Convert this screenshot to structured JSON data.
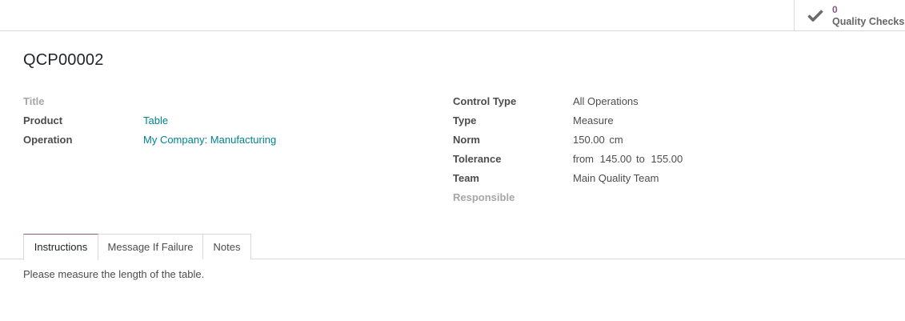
{
  "stat_button": {
    "value": "0",
    "label": "Quality Checks",
    "icon": "check-icon"
  },
  "record": {
    "name": "QCP00002"
  },
  "left_fields": {
    "title_label": "Title",
    "product_label": "Product",
    "product_value": "Table",
    "operation_label": "Operation",
    "operation_value": "My Company: Manufacturing"
  },
  "right_fields": {
    "control_type_label": "Control Type",
    "control_type_value": "All Operations",
    "type_label": "Type",
    "type_value": "Measure",
    "norm_label": "Norm",
    "norm_value": "150.00",
    "norm_unit": "cm",
    "tolerance_label": "Tolerance",
    "tolerance_from": "from",
    "tolerance_min": "145.00",
    "tolerance_to": "to",
    "tolerance_max": "155.00",
    "team_label": "Team",
    "team_value": "Main Quality Team",
    "responsible_label": "Responsible"
  },
  "tabs": [
    {
      "label": "Instructions",
      "active": true
    },
    {
      "label": "Message If Failure",
      "active": false
    },
    {
      "label": "Notes",
      "active": false
    }
  ],
  "tab_content": {
    "text": "Please measure the length of the table."
  },
  "colors": {
    "accent": "#875a7b",
    "link": "#00838f",
    "border": "#d9d9d9",
    "muted": "#a6a6a6"
  }
}
